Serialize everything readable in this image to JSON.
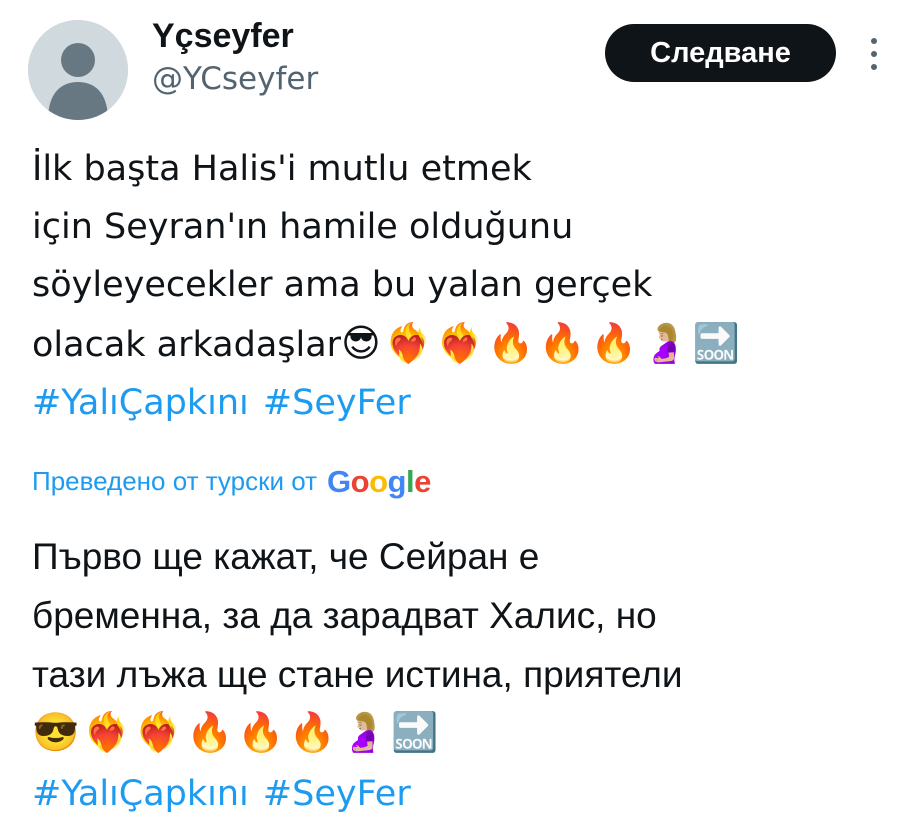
{
  "author": {
    "display_name": "Yçseyfer",
    "handle": "@YCseyfer",
    "avatar_icon": "default-profile-avatar"
  },
  "follow_button": {
    "label": "Следване"
  },
  "more_icon": "more-vertical-icon",
  "tweet": {
    "lines": [
      "İlk başta Halis'i mutlu etmek",
      "için Seyran'ın hamile olduğunu",
      "söyleyecekler ama bu yalan gerçek",
      "olacak arkadaşlar"
    ],
    "emojis": "😎❤️‍🔥❤️‍🔥🔥🔥🔥🤰🏼🔜",
    "hashtags": [
      "#YalıÇapkını",
      "#SeyFer"
    ]
  },
  "translation_label": {
    "text": "Преведено от турски от",
    "provider": "Google"
  },
  "translation": {
    "lines": [
      "Първо ще кажат, че Сейран е",
      "бременна, за да зарадват Халис, но",
      "тази лъжа ще стане истина, приятели"
    ],
    "emojis": "😎❤️‍🔥❤️‍🔥🔥🔥🔥🤰🏼🔜",
    "hashtags": [
      "#YalıÇapkını",
      "#SeyFer"
    ]
  },
  "colors": {
    "text": "#0f1419",
    "secondary": "#536471",
    "link": "#1d9bf0",
    "button_bg": "#0f1419",
    "avatar_bg": "#cfd9de"
  }
}
